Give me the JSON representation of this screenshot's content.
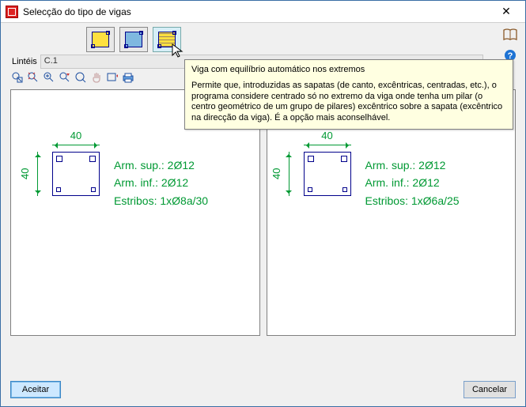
{
  "window_title": "Selecção do tipo de vigas",
  "toolbar": {
    "btn1_name": "beam-type-1",
    "btn2_name": "beam-type-2",
    "btn3_name": "beam-type-3"
  },
  "tooltip": {
    "title": "Viga com equilíbrio automático nos extremos",
    "body": "Permite que, introduzidas as sapatas (de canto, excêntricas, centradas, etc.), o programa considere centrado só no extremo da viga onde tenha um pilar (o centro geométrico de um grupo de pilares) excêntrico sobre a sapata (excêntrico na direcção da viga). É a opção mais aconselhável."
  },
  "label": "Lintéis",
  "field_value": "C.1",
  "panels": [
    {
      "width_label": "40",
      "height_label": "40",
      "arm_sup": "Arm. sup.: 2Ø12",
      "arm_inf": "Arm. inf.: 2Ø12",
      "estribos": "Estribos: 1xØ8a/30"
    },
    {
      "width_label": "40",
      "height_label": "40",
      "arm_sup": "Arm. sup.: 2Ø12",
      "arm_inf": "Arm. inf.: 2Ø12",
      "estribos": "Estribos: 1xØ6a/25"
    }
  ],
  "buttons": {
    "accept": "Aceitar",
    "cancel": "Cancelar"
  }
}
